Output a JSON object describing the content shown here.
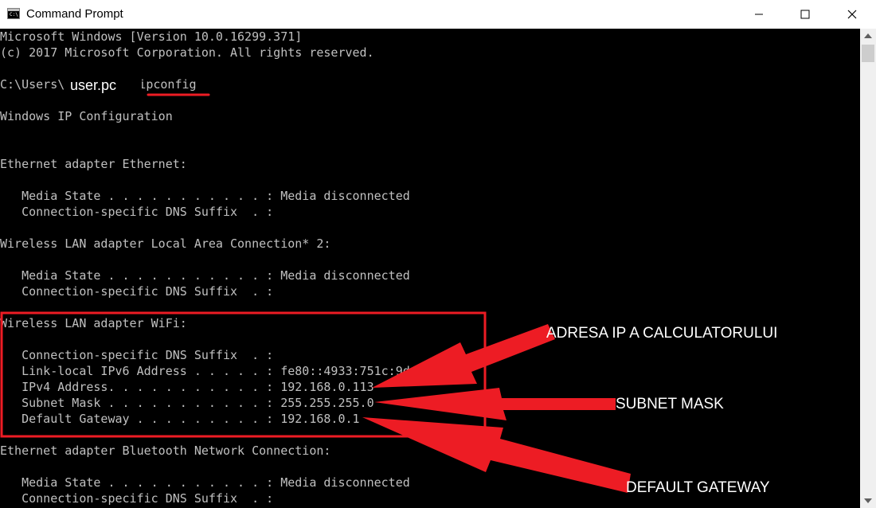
{
  "window": {
    "title": "Command Prompt",
    "icon": "cmd-icon",
    "icon_text": "C:\\",
    "controls": [
      "minimize-icon",
      "maximize-icon",
      "close-icon"
    ]
  },
  "console": {
    "lines": [
      "Microsoft Windows [Version 10.0.16299.371]",
      "(c) 2017 Microsoft Corporation. All rights reserved.",
      "",
      "C:\\Users\\",
      "",
      "Windows IP Configuration",
      "",
      "",
      "Ethernet adapter Ethernet:",
      "",
      "   Media State . . . . . . . . . . . : Media disconnected",
      "   Connection-specific DNS Suffix  . :",
      "",
      "Wireless LAN adapter Local Area Connection* 2:",
      "",
      "   Media State . . . . . . . . . . . : Media disconnected",
      "   Connection-specific DNS Suffix  . :",
      "",
      "Wireless LAN adapter WiFi:",
      "",
      "   Connection-specific DNS Suffix  . :",
      "   Link-local IPv6 Address . . . . . : fe80::4933:751c:9d",
      "   IPv4 Address. . . . . . . . . . . : 192.168.0.113",
      "   Subnet Mask . . . . . . . . . . . : 255.255.255.0",
      "   Default Gateway . . . . . . . . . : 192.168.0.1",
      "",
      "Ethernet adapter Bluetooth Network Connection:",
      "",
      "   Media State . . . . . . . . . . . : Media disconnected",
      "   Connection-specific DNS Suffix  . :"
    ],
    "prompt_command": ">ipconfig",
    "username_overlay": "user.pc"
  },
  "annotations": {
    "ip_label": "ADRESA IP A CALCULATORULUI",
    "subnet_label": "SUBNET MASK",
    "gateway_label": "DEFAULT GATEWAY",
    "accent_color": "#ed1c24"
  },
  "scrollbar": {
    "up_icon": "scroll-up-arrow-icon",
    "down_icon": "scroll-down-arrow-icon"
  }
}
